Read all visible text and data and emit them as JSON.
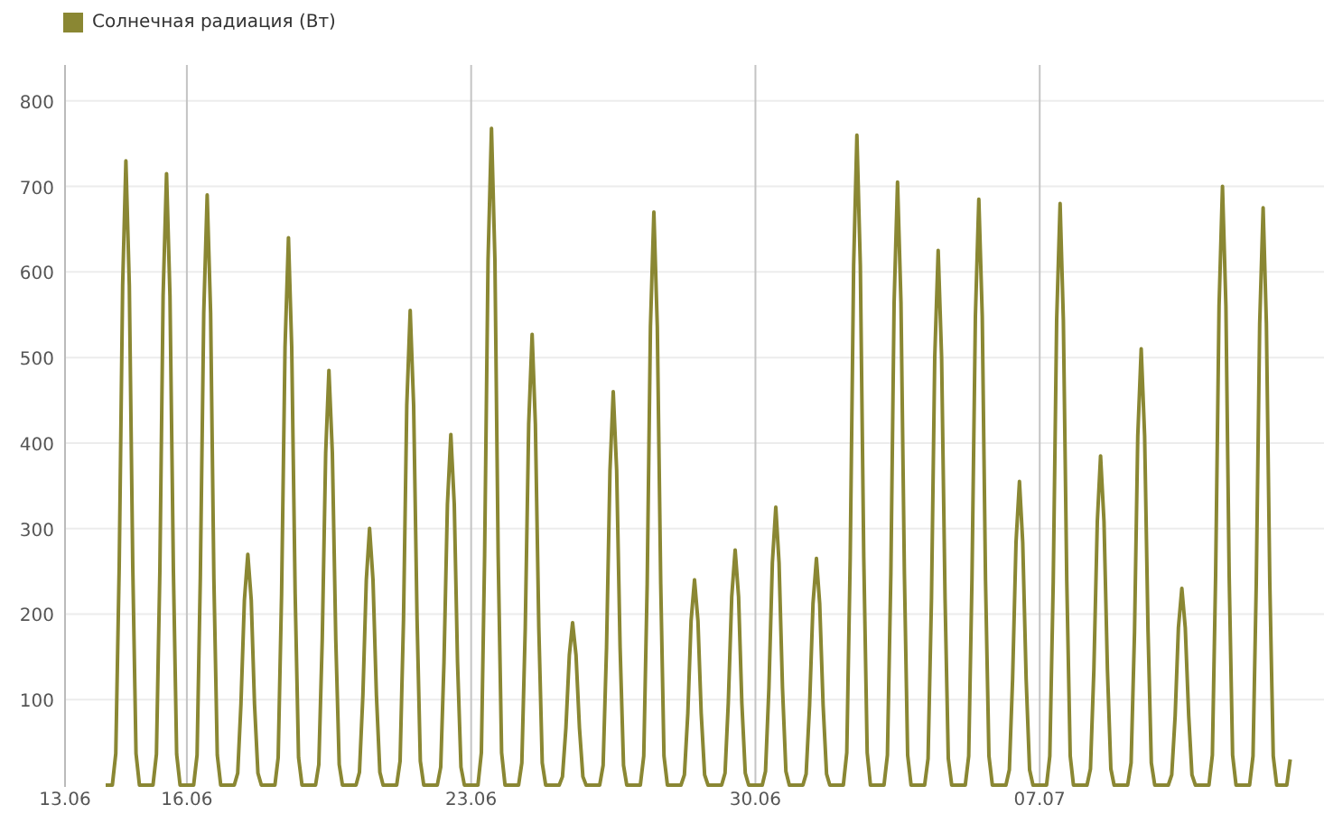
{
  "chart_data": {
    "type": "line",
    "grid": true,
    "categories": [
      "13.06",
      null,
      null,
      null,
      null,
      null,
      null,
      null,
      null,
      null,
      null,
      null,
      null,
      null,
      null,
      null,
      null,
      null,
      null,
      null,
      null,
      null,
      null,
      null,
      null,
      null,
      null,
      null,
      null,
      null,
      null,
      null,
      null,
      null,
      null,
      null,
      "16.06",
      null,
      null,
      null,
      null,
      null,
      null,
      null,
      null,
      null,
      null,
      null,
      null,
      null,
      null,
      null,
      null,
      null,
      null,
      null,
      null,
      null,
      null,
      null,
      null,
      null,
      null,
      null,
      null,
      null,
      null,
      null,
      null,
      null,
      null,
      null,
      null,
      null,
      null,
      null,
      null,
      null,
      null,
      null,
      null,
      null,
      null,
      null,
      null,
      null,
      null,
      null,
      null,
      null,
      null,
      null,
      null,
      null,
      null,
      null,
      null,
      null,
      null,
      null,
      null,
      null,
      null,
      null,
      null,
      null,
      null,
      null,
      null,
      null,
      null,
      null,
      null,
      null,
      null,
      null,
      null,
      null,
      null,
      null,
      "23.06",
      null,
      null,
      null,
      null,
      null,
      null,
      null,
      null,
      null,
      null,
      null,
      null,
      null,
      null,
      null,
      null,
      null,
      null,
      null,
      null,
      null,
      null,
      null,
      null,
      null,
      null,
      null,
      null,
      null,
      null,
      null,
      null,
      null,
      null,
      null,
      null,
      null,
      null,
      null,
      null,
      null,
      null,
      null,
      null,
      null,
      null,
      null,
      null,
      null,
      null,
      null,
      null,
      null,
      null,
      null,
      null,
      null,
      null,
      null,
      null,
      null,
      null,
      null,
      null,
      null,
      null,
      null,
      null,
      null,
      null,
      null,
      null,
      null,
      null,
      null,
      null,
      null,
      null,
      null,
      null,
      null,
      null,
      null,
      "30.06",
      null,
      null,
      null,
      null,
      null,
      null,
      null,
      null,
      null,
      null,
      null,
      null,
      null,
      null,
      null,
      null,
      null,
      null,
      null,
      null,
      null,
      null,
      null,
      null,
      null,
      null,
      null,
      null,
      null,
      null,
      null,
      null,
      null,
      null,
      null,
      null,
      null,
      null,
      null,
      null,
      null,
      null,
      null,
      null,
      null,
      null,
      null,
      null,
      null,
      null,
      null,
      null,
      null,
      null,
      null,
      null,
      null,
      null,
      null,
      null,
      null,
      null,
      null,
      null,
      null,
      null,
      null,
      null,
      null,
      null,
      null,
      null,
      null,
      null,
      null,
      null,
      null,
      null,
      null,
      null,
      null,
      null,
      null,
      "07.07",
      null,
      null,
      null,
      null,
      null,
      null,
      null,
      null,
      null,
      null,
      null,
      null,
      null,
      null,
      null,
      null,
      null,
      null,
      null,
      null,
      null,
      null,
      null,
      null,
      null,
      null,
      null,
      null,
      null,
      null,
      null,
      null,
      null,
      null,
      null,
      null,
      null,
      null,
      null,
      null,
      null,
      null,
      null,
      null,
      null,
      null,
      null,
      null,
      null,
      null,
      null,
      null,
      null,
      null,
      null,
      null,
      null,
      null,
      null,
      null,
      null,
      null,
      null,
      null,
      null,
      null,
      null,
      null,
      null,
      null,
      null,
      null,
      null,
      null
    ],
    "series": [
      {
        "name": "Солнечная радиация (Вт)",
        "color": "#8a8733",
        "values": [
          null,
          null,
          null,
          null,
          null,
          null,
          null,
          null,
          null,
          null,
          null,
          null,
          0,
          0,
          0,
          37,
          256,
          584,
          730,
          584,
          256,
          37,
          0,
          0,
          0,
          0,
          0,
          36,
          250,
          572,
          715,
          572,
          250,
          36,
          0,
          0,
          0,
          0,
          0,
          35,
          242,
          552,
          690,
          552,
          242,
          35,
          0,
          0,
          0,
          0,
          0,
          14,
          95,
          216,
          270,
          216,
          95,
          14,
          0,
          0,
          0,
          0,
          0,
          32,
          224,
          512,
          640,
          512,
          224,
          32,
          0,
          0,
          0,
          0,
          0,
          24,
          170,
          388,
          485,
          388,
          170,
          24,
          0,
          0,
          0,
          0,
          0,
          15,
          105,
          240,
          300,
          240,
          105,
          15,
          0,
          0,
          0,
          0,
          0,
          28,
          194,
          444,
          555,
          444,
          194,
          28,
          0,
          0,
          0,
          0,
          0,
          21,
          144,
          328,
          410,
          328,
          144,
          21,
          0,
          0,
          0,
          0,
          0,
          38,
          269,
          614,
          768,
          614,
          269,
          38,
          0,
          0,
          0,
          0,
          0,
          26,
          184,
          422,
          527,
          422,
          184,
          26,
          0,
          0,
          0,
          0,
          0,
          10,
          67,
          152,
          190,
          152,
          67,
          10,
          0,
          0,
          0,
          0,
          0,
          23,
          161,
          368,
          460,
          368,
          161,
          23,
          0,
          0,
          0,
          0,
          0,
          34,
          235,
          536,
          670,
          536,
          235,
          34,
          0,
          0,
          0,
          0,
          0,
          12,
          84,
          192,
          240,
          192,
          84,
          12,
          0,
          0,
          0,
          0,
          0,
          14,
          96,
          220,
          275,
          220,
          96,
          14,
          0,
          0,
          0,
          0,
          0,
          16,
          114,
          260,
          325,
          260,
          114,
          16,
          0,
          0,
          0,
          0,
          0,
          13,
          93,
          212,
          265,
          212,
          93,
          13,
          0,
          0,
          0,
          0,
          0,
          38,
          266,
          608,
          760,
          608,
          266,
          38,
          0,
          0,
          0,
          0,
          0,
          35,
          247,
          564,
          705,
          564,
          247,
          35,
          0,
          0,
          0,
          0,
          0,
          31,
          219,
          500,
          625,
          500,
          219,
          31,
          0,
          0,
          0,
          0,
          0,
          34,
          240,
          548,
          685,
          548,
          240,
          34,
          0,
          0,
          0,
          0,
          0,
          18,
          124,
          284,
          355,
          284,
          124,
          18,
          0,
          0,
          0,
          0,
          0,
          34,
          238,
          544,
          680,
          544,
          238,
          34,
          0,
          0,
          0,
          0,
          0,
          19,
          135,
          308,
          385,
          308,
          135,
          19,
          0,
          0,
          0,
          0,
          0,
          26,
          179,
          408,
          510,
          408,
          179,
          26,
          0,
          0,
          0,
          0,
          0,
          12,
          81,
          184,
          230,
          184,
          81,
          12,
          0,
          0,
          0,
          0,
          0,
          35,
          245,
          560,
          700,
          560,
          245,
          35,
          0,
          0,
          0,
          0,
          0,
          34,
          236,
          540,
          675,
          540,
          236,
          34,
          0,
          0,
          0,
          0,
          30
        ]
      }
    ],
    "ylim": [
      0,
      842
    ],
    "yticks": [
      100,
      200,
      300,
      400,
      500,
      600,
      700,
      800
    ]
  }
}
